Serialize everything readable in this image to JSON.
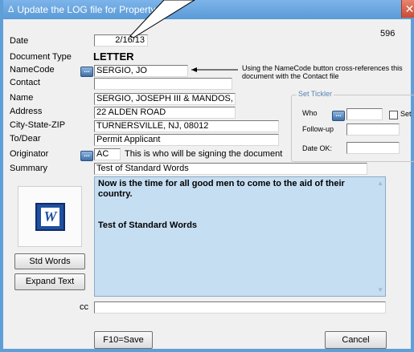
{
  "window": {
    "title": "Update the LOG file for Property",
    "record_number": "596",
    "close_label": "✕"
  },
  "form": {
    "date_label": "Date",
    "date_value": "2/16/13",
    "doctype_label": "Document Type",
    "doctype_value": "LETTER",
    "namecode_label": "NameCode",
    "namecode_value": "SERGIO, JO",
    "namecode_note": "Using the NameCode button cross-references this document with the Contact file",
    "contact_label": "Contact",
    "contact_value": "",
    "name_label": "Name",
    "name_value": "SERGIO, JOSEPH III & MANDOS,",
    "address_label": "Address",
    "address_value": "22 ALDEN ROAD",
    "csz_label": "City-State-ZIP",
    "csz_value": "TURNERSVILLE, NJ, 08012",
    "todear_label": "To/Dear",
    "todear_value": "Permit Applicant",
    "originator_label": "Originator",
    "originator_value": "AC",
    "originator_note": "This is who will be signing the document",
    "summary_label": "Summary",
    "summary_value": "Test of Standard Words",
    "cc_label": "cc",
    "cc_value": "",
    "ellipsis_label": "..."
  },
  "tickler": {
    "title": "Set Tickler",
    "who_label": "Who",
    "who_value": "",
    "set_label": "Set",
    "followup_label": "Follow-up",
    "followup_value": "",
    "dateok_label": "Date OK:",
    "dateok_value": ""
  },
  "memo": {
    "paragraphs": [
      "Now is the time for all good men to come to the aid of their country.",
      "Test of Standard Words"
    ]
  },
  "buttons": {
    "std_words": "Std Words",
    "expand_text": "Expand Text",
    "save": "F10=Save",
    "cancel": "Cancel"
  },
  "icons": {
    "word": "W",
    "title_icon": "Δ"
  },
  "colors": {
    "titlebar": "#5a9ad6",
    "memo_bg": "#c6def2",
    "close": "#c84a32"
  }
}
